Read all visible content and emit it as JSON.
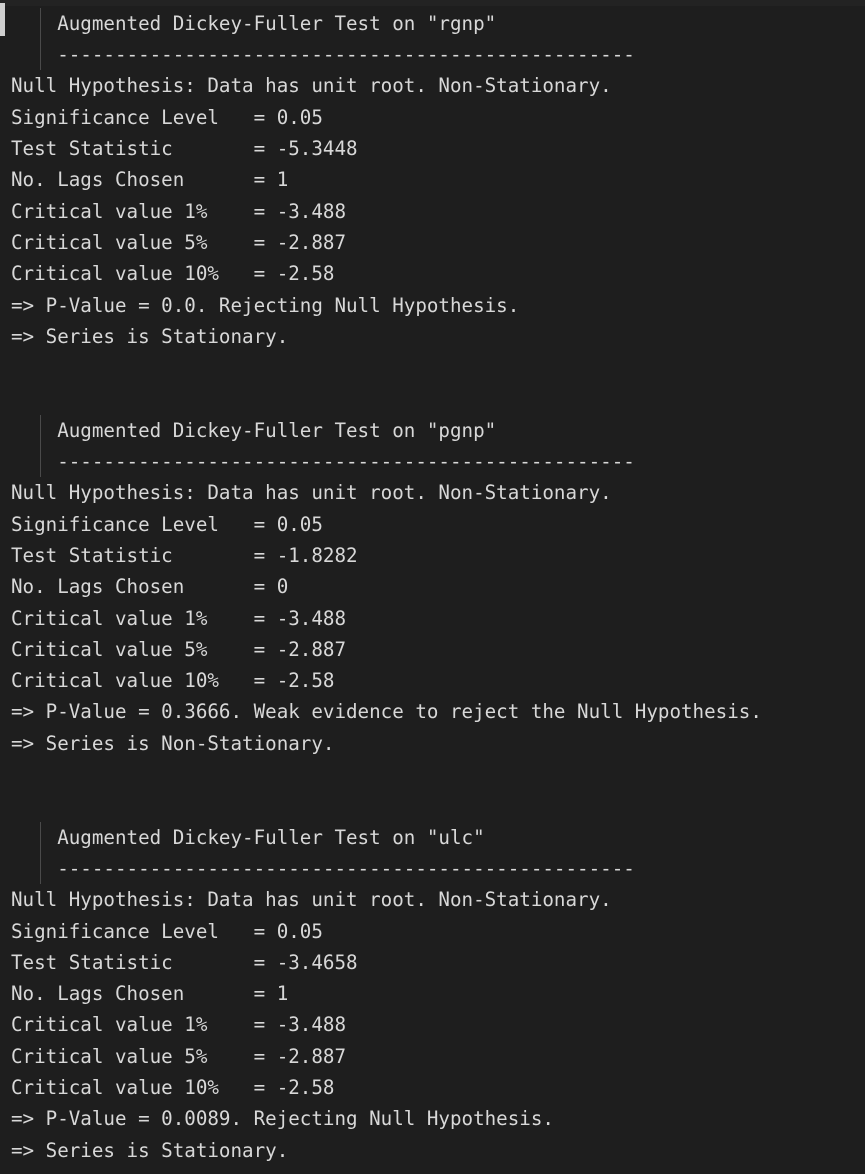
{
  "console": {
    "app": "notebook-output-cell",
    "background_color": "#1e1e1e",
    "text_color": "#d8d8d8",
    "gutter_color": "#232323",
    "indent_guide_color": "#4a4a4a",
    "scroll_indicator_color": "#cfcfcf",
    "font_size_px": 19.2,
    "line_height_px": 31.3,
    "separator_rule": "--------------------------------------------------",
    "null_hypothesis_line": "Null Hypothesis: Data has unit root. Non-Stationary.",
    "labels": {
      "significance_level": "Significance Level",
      "test_statistic": "Test Statistic",
      "no_lags_chosen": "No. Lags Chosen",
      "critical_value_1": "Critical value 1%",
      "critical_value_5": "Critical value 5%",
      "critical_value_10": "Critical value 10%"
    },
    "blocks": [
      {
        "title": "Augmented Dickey-Fuller Test on \"rgnp\"",
        "series": "rgnp",
        "significance_level": "0.05",
        "test_statistic": "-5.3448",
        "no_lags_chosen": "1",
        "critical_value_1": "-3.488",
        "critical_value_5": "-2.887",
        "critical_value_10": "-2.58",
        "p_value_line": "=> P-Value = 0.0. Rejecting Null Hypothesis.",
        "conclusion_line": "=> Series is Stationary.",
        "p_value": "0.0",
        "conclusion": "Stationary"
      },
      {
        "title": "Augmented Dickey-Fuller Test on \"pgnp\"",
        "series": "pgnp",
        "significance_level": "0.05",
        "test_statistic": "-1.8282",
        "no_lags_chosen": "0",
        "critical_value_1": "-3.488",
        "critical_value_5": "-2.887",
        "critical_value_10": "-2.58",
        "p_value_line": "=> P-Value = 0.3666. Weak evidence to reject the Null Hypothesis.",
        "conclusion_line": "=> Series is Non-Stationary.",
        "p_value": "0.3666",
        "conclusion": "Non-Stationary"
      },
      {
        "title": "Augmented Dickey-Fuller Test on \"ulc\"",
        "series": "ulc",
        "significance_level": "0.05",
        "test_statistic": "-3.4658",
        "no_lags_chosen": "1",
        "critical_value_1": "-3.488",
        "critical_value_5": "-2.887",
        "critical_value_10": "-2.58",
        "p_value_line": "=> P-Value = 0.0089. Rejecting Null Hypothesis.",
        "conclusion_line": "=> Series is Stationary.",
        "p_value": "0.0089",
        "conclusion": "Stationary"
      }
    ]
  }
}
